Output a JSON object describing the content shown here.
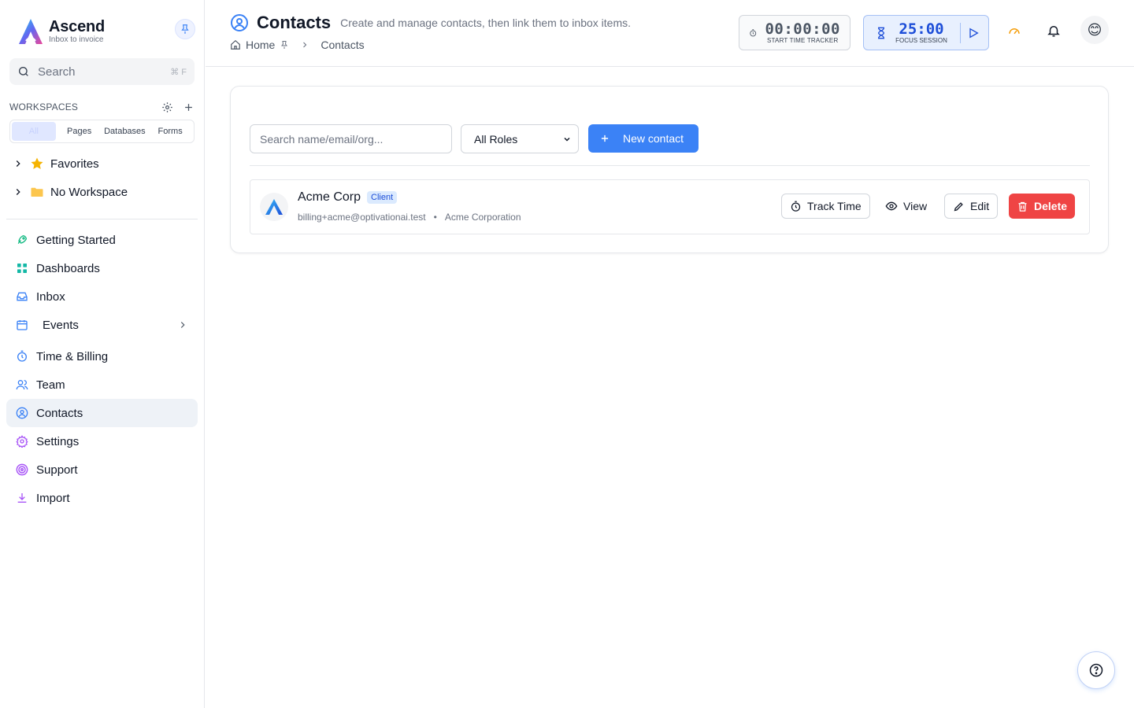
{
  "brand": {
    "name": "Ascend",
    "tagline": "Inbox to invoice"
  },
  "search": {
    "label": "Search",
    "shortcut": "⌘ F"
  },
  "workspaces": {
    "title": "WORKSPACES",
    "segments": [
      "All",
      "Pages",
      "Databases",
      "Forms"
    ],
    "active_segment": "All",
    "tree": [
      {
        "label": "Favorites",
        "icon": "star-icon"
      },
      {
        "label": "No Workspace",
        "icon": "folder-icon"
      }
    ]
  },
  "nav": {
    "items": [
      {
        "label": "Getting Started",
        "icon": "rocket-icon"
      },
      {
        "label": "Dashboards",
        "icon": "grid-icon"
      },
      {
        "label": "Inbox",
        "icon": "inbox-icon"
      },
      {
        "label": "Events",
        "icon": "calendar-icon"
      },
      {
        "label": "Time & Billing",
        "icon": "stopwatch-icon"
      },
      {
        "label": "Team",
        "icon": "users-icon"
      },
      {
        "label": "Contacts",
        "icon": "user-circle-icon"
      },
      {
        "label": "Settings",
        "icon": "gear-icon"
      },
      {
        "label": "Support",
        "icon": "lifebuoy-icon"
      },
      {
        "label": "Import",
        "icon": "download-icon"
      }
    ],
    "active": "Contacts"
  },
  "header": {
    "title": "Contacts",
    "description": "Create and manage contacts, then link them to inbox items.",
    "breadcrumb": {
      "home": "Home",
      "current": "Contacts"
    },
    "timer": {
      "value": "00:00:00",
      "label": "START TIME TRACKER"
    },
    "focus": {
      "value": "25:00",
      "label": "FOCUS SESSION"
    },
    "avatar_emoji": "😊"
  },
  "filters": {
    "search_placeholder": "Search name/email/org...",
    "role_selected": "All Roles",
    "new_button": "New contact"
  },
  "contacts": [
    {
      "name": "Acme Corp",
      "role": "Client",
      "email": "billing+acme@optivationai.test",
      "organization": "Acme Corporation",
      "actions": {
        "track": "Track Time",
        "view": "View",
        "edit": "Edit",
        "delete": "Delete"
      }
    }
  ],
  "colors": {
    "primary": "#3b82f6",
    "danger": "#ef4444",
    "focus_text": "#1d4ed8",
    "badge_bg": "#dbeafe",
    "active_nav_bg": "#eef2f7"
  }
}
